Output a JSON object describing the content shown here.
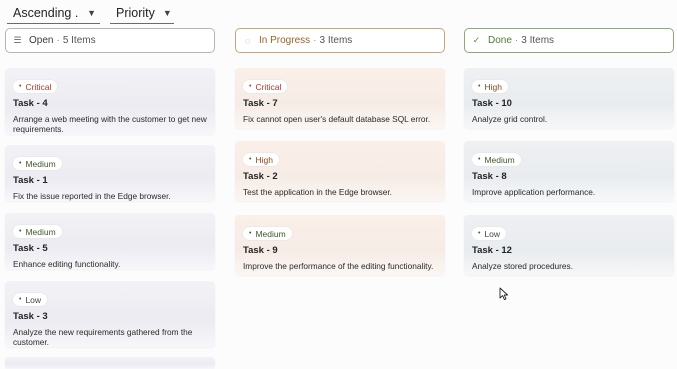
{
  "toolbar": {
    "sort": {
      "value": "Ascending .",
      "caret": "▼"
    },
    "group": {
      "value": "Priority",
      "caret": "▼"
    }
  },
  "columns": [
    {
      "title": "Open",
      "separator": "·",
      "count": "5 Items",
      "icon": "list-icon",
      "icon_glyph": "☰",
      "cards": [
        {
          "priority": "Critical",
          "title": "Task - 4",
          "desc": "Arrange a web meeting with the customer to get new requirements."
        },
        {
          "priority": "Medium",
          "title": "Task - 1",
          "desc": "Fix the issue reported in the Edge browser."
        },
        {
          "priority": "Medium",
          "title": "Task - 5",
          "desc": "Enhance editing functionality."
        },
        {
          "priority": "Low",
          "title": "Task - 3",
          "desc": "Analyze the new requirements gathered from the customer."
        }
      ]
    },
    {
      "title": "In Progress",
      "separator": "·",
      "count": "3 Items",
      "icon": "spinner-icon",
      "icon_glyph": "◌",
      "cards": [
        {
          "priority": "Critical",
          "title": "Task - 7",
          "desc": "Fix cannot open user's default database SQL error."
        },
        {
          "priority": "High",
          "title": "Task - 2",
          "desc": "Test the application in the Edge browser."
        },
        {
          "priority": "Medium",
          "title": "Task - 9",
          "desc": "Improve the performance of the editing functionality."
        }
      ]
    },
    {
      "title": "Done",
      "separator": "·",
      "count": "3 Items",
      "icon": "checkmark-icon",
      "icon_glyph": "✓",
      "cards": [
        {
          "priority": "High",
          "title": "Task - 10",
          "desc": "Analyze grid control."
        },
        {
          "priority": "Medium",
          "title": "Task - 8",
          "desc": "Improve application performance."
        },
        {
          "priority": "Low",
          "title": "Task - 12",
          "desc": "Analyze stored procedures."
        }
      ]
    }
  ],
  "badge_dot": "•"
}
